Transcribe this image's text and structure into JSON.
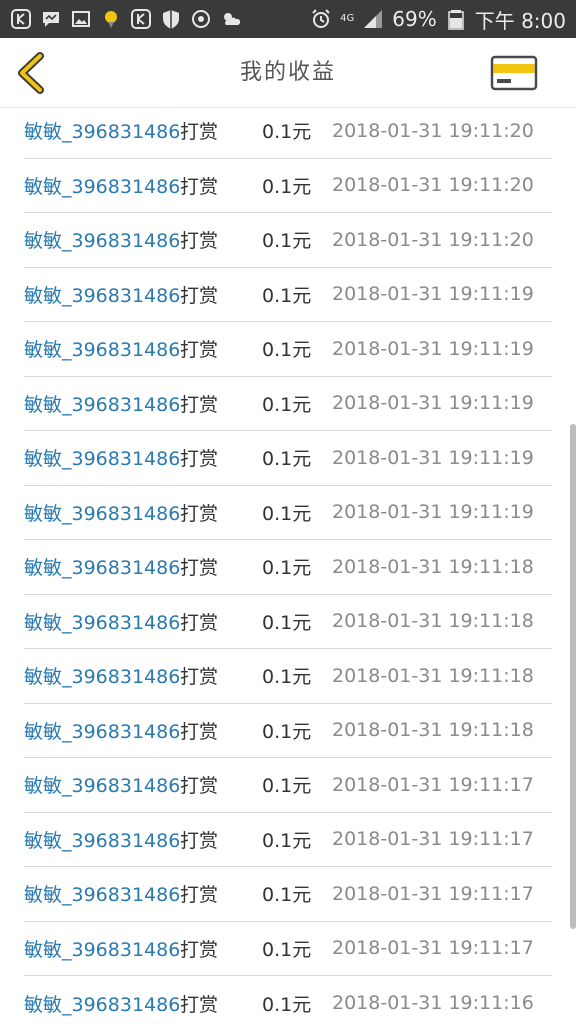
{
  "status_bar": {
    "battery_percent": "69%",
    "network": "4G",
    "time": "下午 8:00"
  },
  "header": {
    "title": "我的收益"
  },
  "records": [
    {
      "user": "敏敏_396831486",
      "action": "打赏",
      "amount": "0.1元",
      "time": "2018-01-31 19:11:20"
    },
    {
      "user": "敏敏_396831486",
      "action": "打赏",
      "amount": "0.1元",
      "time": "2018-01-31 19:11:20"
    },
    {
      "user": "敏敏_396831486",
      "action": "打赏",
      "amount": "0.1元",
      "time": "2018-01-31 19:11:20"
    },
    {
      "user": "敏敏_396831486",
      "action": "打赏",
      "amount": "0.1元",
      "time": "2018-01-31 19:11:19"
    },
    {
      "user": "敏敏_396831486",
      "action": "打赏",
      "amount": "0.1元",
      "time": "2018-01-31 19:11:19"
    },
    {
      "user": "敏敏_396831486",
      "action": "打赏",
      "amount": "0.1元",
      "time": "2018-01-31 19:11:19"
    },
    {
      "user": "敏敏_396831486",
      "action": "打赏",
      "amount": "0.1元",
      "time": "2018-01-31 19:11:19"
    },
    {
      "user": "敏敏_396831486",
      "action": "打赏",
      "amount": "0.1元",
      "time": "2018-01-31 19:11:19"
    },
    {
      "user": "敏敏_396831486",
      "action": "打赏",
      "amount": "0.1元",
      "time": "2018-01-31 19:11:18"
    },
    {
      "user": "敏敏_396831486",
      "action": "打赏",
      "amount": "0.1元",
      "time": "2018-01-31 19:11:18"
    },
    {
      "user": "敏敏_396831486",
      "action": "打赏",
      "amount": "0.1元",
      "time": "2018-01-31 19:11:18"
    },
    {
      "user": "敏敏_396831486",
      "action": "打赏",
      "amount": "0.1元",
      "time": "2018-01-31 19:11:18"
    },
    {
      "user": "敏敏_396831486",
      "action": "打赏",
      "amount": "0.1元",
      "time": "2018-01-31 19:11:17"
    },
    {
      "user": "敏敏_396831486",
      "action": "打赏",
      "amount": "0.1元",
      "time": "2018-01-31 19:11:17"
    },
    {
      "user": "敏敏_396831486",
      "action": "打赏",
      "amount": "0.1元",
      "time": "2018-01-31 19:11:17"
    },
    {
      "user": "敏敏_396831486",
      "action": "打赏",
      "amount": "0.1元",
      "time": "2018-01-31 19:11:17"
    },
    {
      "user": "敏敏_396831486",
      "action": "打赏",
      "amount": "0.1元",
      "time": "2018-01-31 19:11:16"
    }
  ],
  "colors": {
    "accent": "#f1c40f",
    "username": "#2a7ab0",
    "timestamp": "#8a8a8a"
  },
  "icons": {
    "back": "chevron-left-icon",
    "card": "credit-card-icon"
  }
}
